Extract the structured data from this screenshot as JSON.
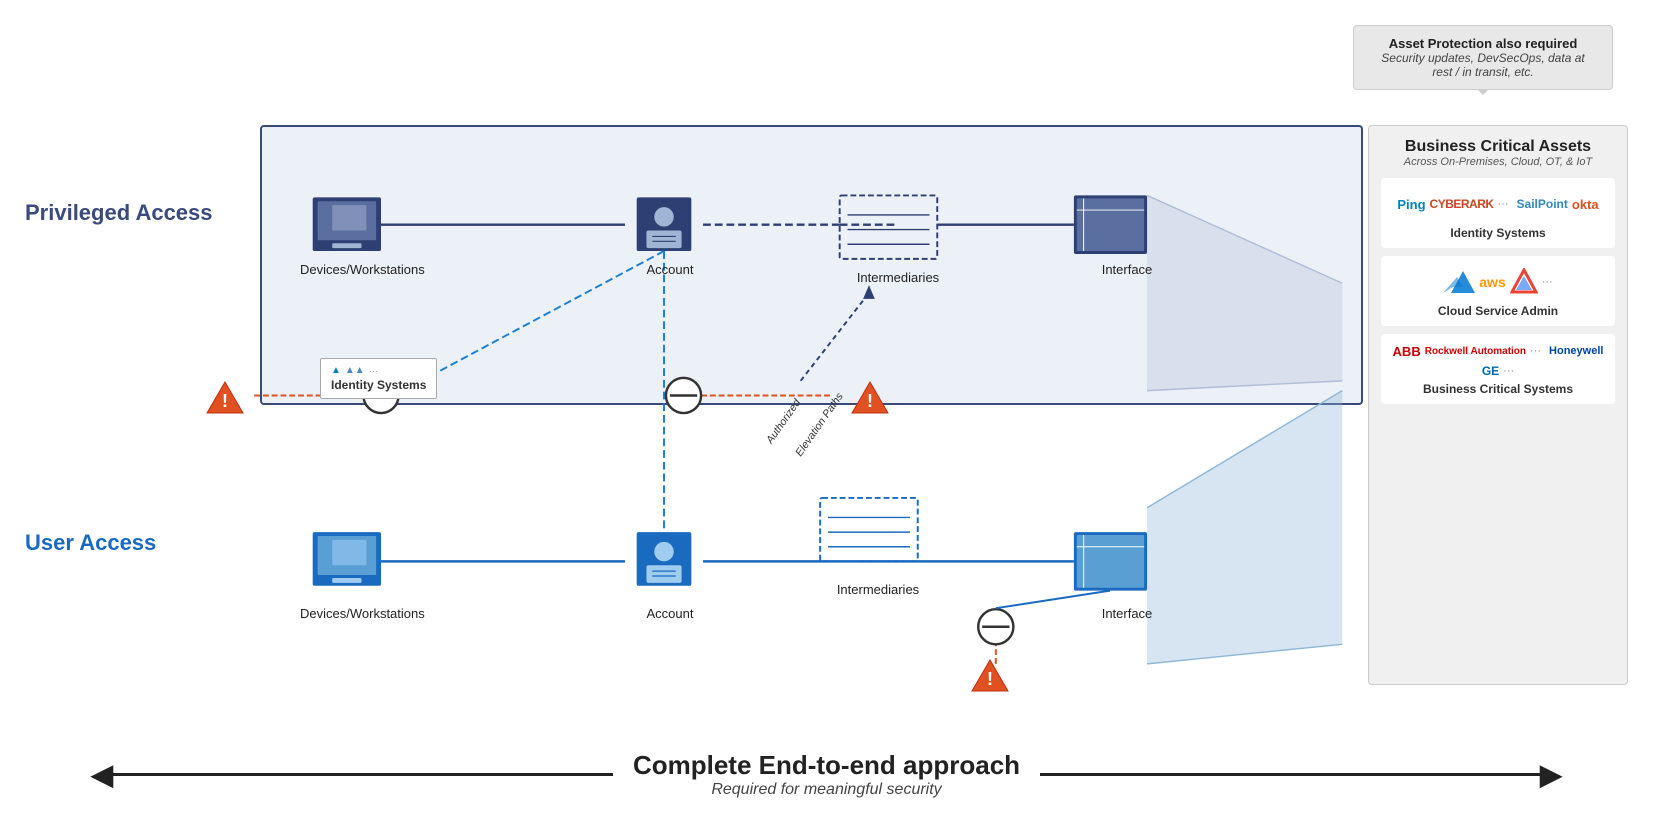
{
  "assetProtection": {
    "title": "Asset Protection also required",
    "subtitle": "Security updates, DevSecOps, data at rest / in transit, etc."
  },
  "privilegedAccess": {
    "label": "Privileged Access"
  },
  "userAccess": {
    "label": "User Access"
  },
  "nodes": {
    "privDevices": "Devices/Workstations",
    "privAccount": "Account",
    "privIntermediaries": "Intermediaries",
    "privInterface": "Interface",
    "userDevices": "Devices/Workstations",
    "userAccount": "Account",
    "userIntermediaries": "Intermediaries",
    "userInterface": "Interface"
  },
  "identityPopup": {
    "label": "Identity Systems"
  },
  "authorizedElevation": "Authorized Elevation Paths",
  "businessCriticalAssets": {
    "title": "Business Critical Assets",
    "subtitle": "Across On-Premises, Cloud, OT, & IoT",
    "sections": [
      {
        "name": "identitySystems",
        "label": "Identity Systems",
        "logos": [
          "Ping",
          "CYBERARK",
          "SailPoint",
          "okta",
          "..."
        ]
      },
      {
        "name": "cloudServiceAdmin",
        "label": "Cloud Service Admin",
        "logos": [
          "azure",
          "aws",
          "gcp",
          "..."
        ]
      },
      {
        "name": "businessCriticalSystems",
        "label": "Business Critical Systems",
        "logos": [
          "ABB",
          "Rockwell",
          "Honeywell",
          "GE",
          "..."
        ]
      }
    ]
  },
  "endToEnd": {
    "title": "Complete End-to-end approach",
    "subtitle": "Required for meaningful security"
  }
}
